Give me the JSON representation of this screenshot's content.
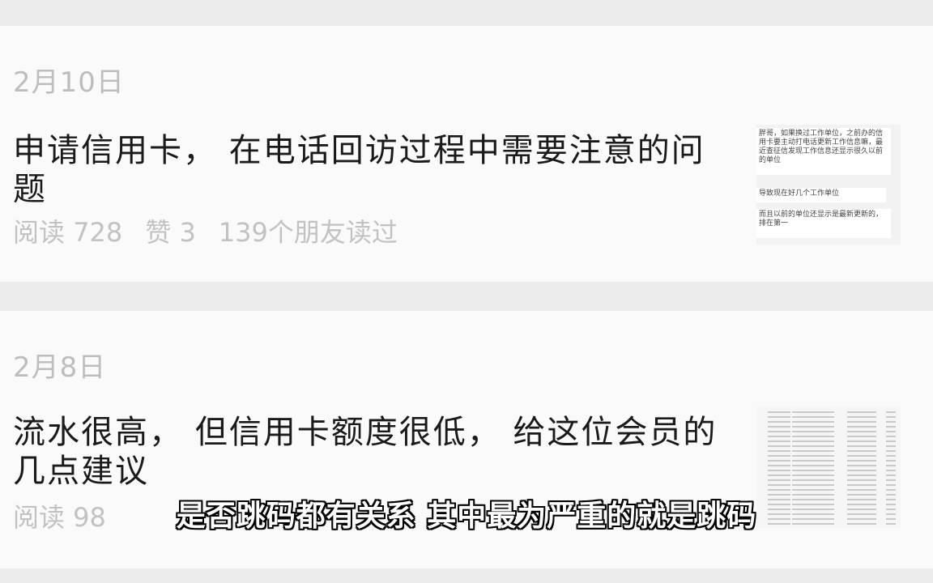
{
  "articles": [
    {
      "date": "2月10日",
      "title": "申请信用卡， 在电话回访过程中需要注意的问题",
      "reads": "阅读 728",
      "likes": "赞 3",
      "friends": "139个朋友读过",
      "thumbnail": {
        "msg1": "胖哥，如果换过工作单位，之前办的信用卡要主动打电话更新工作信息嘛，最近查征信发现工作信息还显示很久以前的单位",
        "msg2": "导致现在好几个工作单位",
        "msg3": "而且以前的单位还显示是最新更新的，排在第一"
      }
    },
    {
      "date": "2月8日",
      "title": "流水很高， 但信用卡额度很低， 给这位会员的几点建议",
      "reads": "阅读 98"
    }
  ],
  "subtitle": "是否跳码都有关系 其中最为严重的就是跳码"
}
